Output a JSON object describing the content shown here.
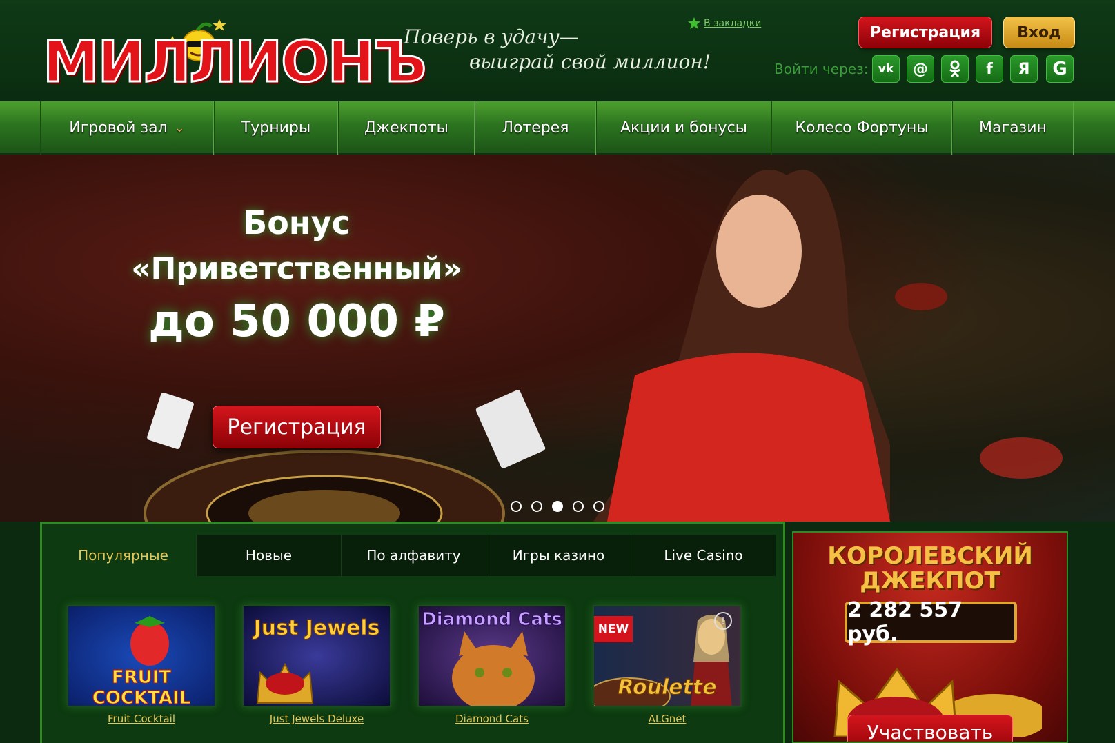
{
  "header": {
    "logo_text": "МИЛЛИОНЪ",
    "slogan_line1": "Поверь в удачу—",
    "slogan_line2": "выиграй свой миллион!",
    "bookmark": "В закладки",
    "register_button": "Регистрация",
    "login_button": "Вход",
    "login_via": "Войти через:",
    "social": [
      {
        "icon": "vk-icon",
        "glyph": "vk"
      },
      {
        "icon": "mailru-icon",
        "glyph": "@"
      },
      {
        "icon": "odnoklassniki-icon",
        "glyph": "ok"
      },
      {
        "icon": "facebook-icon",
        "glyph": "f"
      },
      {
        "icon": "yandex-icon",
        "glyph": "Я"
      },
      {
        "icon": "google-icon",
        "glyph": "G"
      }
    ]
  },
  "nav": {
    "items": [
      "Игровой зал",
      "Турниры",
      "Джекпоты",
      "Лотерея",
      "Акции и бонусы",
      "Колесо Фортуны",
      "Магазин"
    ]
  },
  "hero": {
    "line1": "Бонус",
    "line2": "«Приветственный»",
    "line3": "до 50 000 ₽",
    "button": "Регистрация",
    "slides_total": 5,
    "active_slide": 3
  },
  "games": {
    "tabs": [
      "Популярные",
      "Новые",
      "По алфавиту",
      "Игры казино",
      "Live Casino"
    ],
    "active_tab": 0,
    "items": [
      {
        "name": "Fruit Cocktail",
        "thumb_title": "FRUIT COCKTAIL",
        "badge": ""
      },
      {
        "name": "Just Jewels Deluxe",
        "thumb_title": "Just Jewels",
        "badge": ""
      },
      {
        "name": "Diamond Cats",
        "thumb_title": "Diamond Cats",
        "badge": ""
      },
      {
        "name": "ALGnet",
        "thumb_title": "Roulette",
        "badge": "NEW"
      }
    ]
  },
  "jackpot": {
    "title_line1": "КОРОЛЕВСКИЙ",
    "title_line2": "ДЖЕКПОТ",
    "amount": "2 282 557 руб.",
    "button": "Участвовать"
  },
  "colors": {
    "header_bg": "#0f3a16",
    "nav_green": "#2c7420",
    "red_button": "#c8101a",
    "gold_button": "#e8b23a",
    "label_gold": "#e3c75a"
  }
}
